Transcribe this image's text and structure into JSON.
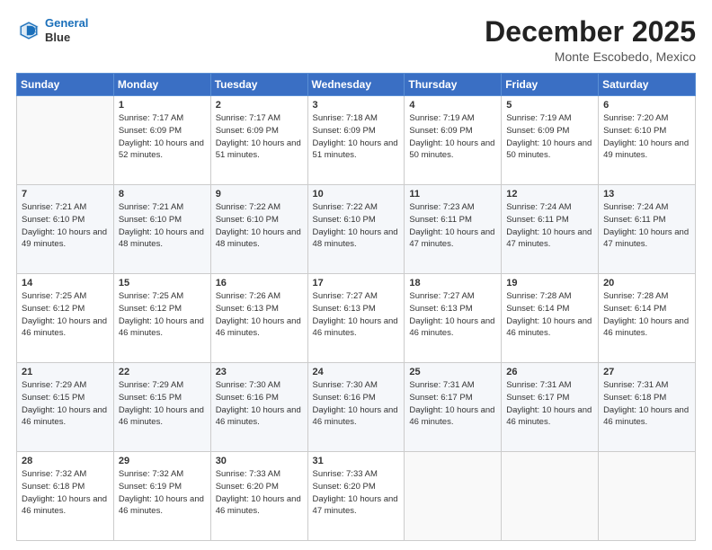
{
  "logo": {
    "line1": "General",
    "line2": "Blue"
  },
  "header": {
    "month": "December 2025",
    "location": "Monte Escobedo, Mexico"
  },
  "days_of_week": [
    "Sunday",
    "Monday",
    "Tuesday",
    "Wednesday",
    "Thursday",
    "Friday",
    "Saturday"
  ],
  "weeks": [
    [
      {
        "day": "",
        "sunrise": "",
        "sunset": "",
        "daylight": ""
      },
      {
        "day": "1",
        "sunrise": "Sunrise: 7:17 AM",
        "sunset": "Sunset: 6:09 PM",
        "daylight": "Daylight: 10 hours and 52 minutes."
      },
      {
        "day": "2",
        "sunrise": "Sunrise: 7:17 AM",
        "sunset": "Sunset: 6:09 PM",
        "daylight": "Daylight: 10 hours and 51 minutes."
      },
      {
        "day": "3",
        "sunrise": "Sunrise: 7:18 AM",
        "sunset": "Sunset: 6:09 PM",
        "daylight": "Daylight: 10 hours and 51 minutes."
      },
      {
        "day": "4",
        "sunrise": "Sunrise: 7:19 AM",
        "sunset": "Sunset: 6:09 PM",
        "daylight": "Daylight: 10 hours and 50 minutes."
      },
      {
        "day": "5",
        "sunrise": "Sunrise: 7:19 AM",
        "sunset": "Sunset: 6:09 PM",
        "daylight": "Daylight: 10 hours and 50 minutes."
      },
      {
        "day": "6",
        "sunrise": "Sunrise: 7:20 AM",
        "sunset": "Sunset: 6:10 PM",
        "daylight": "Daylight: 10 hours and 49 minutes."
      }
    ],
    [
      {
        "day": "7",
        "sunrise": "Sunrise: 7:21 AM",
        "sunset": "Sunset: 6:10 PM",
        "daylight": "Daylight: 10 hours and 49 minutes."
      },
      {
        "day": "8",
        "sunrise": "Sunrise: 7:21 AM",
        "sunset": "Sunset: 6:10 PM",
        "daylight": "Daylight: 10 hours and 48 minutes."
      },
      {
        "day": "9",
        "sunrise": "Sunrise: 7:22 AM",
        "sunset": "Sunset: 6:10 PM",
        "daylight": "Daylight: 10 hours and 48 minutes."
      },
      {
        "day": "10",
        "sunrise": "Sunrise: 7:22 AM",
        "sunset": "Sunset: 6:10 PM",
        "daylight": "Daylight: 10 hours and 48 minutes."
      },
      {
        "day": "11",
        "sunrise": "Sunrise: 7:23 AM",
        "sunset": "Sunset: 6:11 PM",
        "daylight": "Daylight: 10 hours and 47 minutes."
      },
      {
        "day": "12",
        "sunrise": "Sunrise: 7:24 AM",
        "sunset": "Sunset: 6:11 PM",
        "daylight": "Daylight: 10 hours and 47 minutes."
      },
      {
        "day": "13",
        "sunrise": "Sunrise: 7:24 AM",
        "sunset": "Sunset: 6:11 PM",
        "daylight": "Daylight: 10 hours and 47 minutes."
      }
    ],
    [
      {
        "day": "14",
        "sunrise": "Sunrise: 7:25 AM",
        "sunset": "Sunset: 6:12 PM",
        "daylight": "Daylight: 10 hours and 46 minutes."
      },
      {
        "day": "15",
        "sunrise": "Sunrise: 7:25 AM",
        "sunset": "Sunset: 6:12 PM",
        "daylight": "Daylight: 10 hours and 46 minutes."
      },
      {
        "day": "16",
        "sunrise": "Sunrise: 7:26 AM",
        "sunset": "Sunset: 6:13 PM",
        "daylight": "Daylight: 10 hours and 46 minutes."
      },
      {
        "day": "17",
        "sunrise": "Sunrise: 7:27 AM",
        "sunset": "Sunset: 6:13 PM",
        "daylight": "Daylight: 10 hours and 46 minutes."
      },
      {
        "day": "18",
        "sunrise": "Sunrise: 7:27 AM",
        "sunset": "Sunset: 6:13 PM",
        "daylight": "Daylight: 10 hours and 46 minutes."
      },
      {
        "day": "19",
        "sunrise": "Sunrise: 7:28 AM",
        "sunset": "Sunset: 6:14 PM",
        "daylight": "Daylight: 10 hours and 46 minutes."
      },
      {
        "day": "20",
        "sunrise": "Sunrise: 7:28 AM",
        "sunset": "Sunset: 6:14 PM",
        "daylight": "Daylight: 10 hours and 46 minutes."
      }
    ],
    [
      {
        "day": "21",
        "sunrise": "Sunrise: 7:29 AM",
        "sunset": "Sunset: 6:15 PM",
        "daylight": "Daylight: 10 hours and 46 minutes."
      },
      {
        "day": "22",
        "sunrise": "Sunrise: 7:29 AM",
        "sunset": "Sunset: 6:15 PM",
        "daylight": "Daylight: 10 hours and 46 minutes."
      },
      {
        "day": "23",
        "sunrise": "Sunrise: 7:30 AM",
        "sunset": "Sunset: 6:16 PM",
        "daylight": "Daylight: 10 hours and 46 minutes."
      },
      {
        "day": "24",
        "sunrise": "Sunrise: 7:30 AM",
        "sunset": "Sunset: 6:16 PM",
        "daylight": "Daylight: 10 hours and 46 minutes."
      },
      {
        "day": "25",
        "sunrise": "Sunrise: 7:31 AM",
        "sunset": "Sunset: 6:17 PM",
        "daylight": "Daylight: 10 hours and 46 minutes."
      },
      {
        "day": "26",
        "sunrise": "Sunrise: 7:31 AM",
        "sunset": "Sunset: 6:17 PM",
        "daylight": "Daylight: 10 hours and 46 minutes."
      },
      {
        "day": "27",
        "sunrise": "Sunrise: 7:31 AM",
        "sunset": "Sunset: 6:18 PM",
        "daylight": "Daylight: 10 hours and 46 minutes."
      }
    ],
    [
      {
        "day": "28",
        "sunrise": "Sunrise: 7:32 AM",
        "sunset": "Sunset: 6:18 PM",
        "daylight": "Daylight: 10 hours and 46 minutes."
      },
      {
        "day": "29",
        "sunrise": "Sunrise: 7:32 AM",
        "sunset": "Sunset: 6:19 PM",
        "daylight": "Daylight: 10 hours and 46 minutes."
      },
      {
        "day": "30",
        "sunrise": "Sunrise: 7:33 AM",
        "sunset": "Sunset: 6:20 PM",
        "daylight": "Daylight: 10 hours and 46 minutes."
      },
      {
        "day": "31",
        "sunrise": "Sunrise: 7:33 AM",
        "sunset": "Sunset: 6:20 PM",
        "daylight": "Daylight: 10 hours and 47 minutes."
      },
      {
        "day": "",
        "sunrise": "",
        "sunset": "",
        "daylight": ""
      },
      {
        "day": "",
        "sunrise": "",
        "sunset": "",
        "daylight": ""
      },
      {
        "day": "",
        "sunrise": "",
        "sunset": "",
        "daylight": ""
      }
    ]
  ]
}
